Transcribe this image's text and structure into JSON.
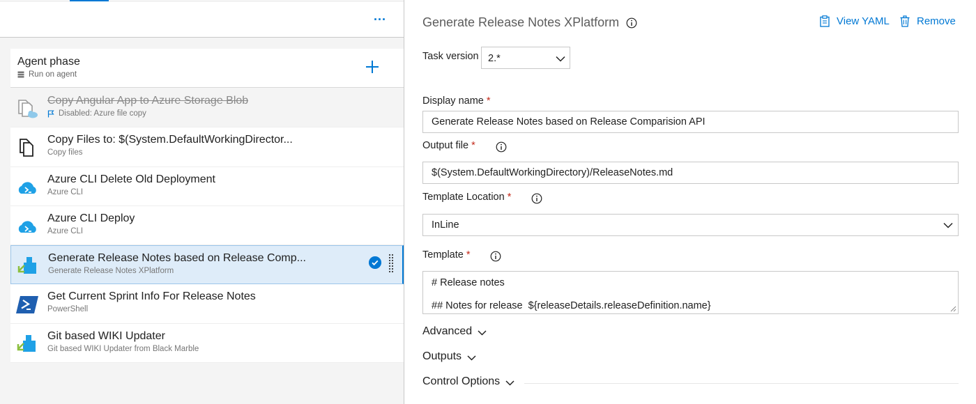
{
  "left_toolbar": {
    "more_label": "..."
  },
  "phase": {
    "title": "Agent phase",
    "subtitle": "Run on agent"
  },
  "tasks": [
    {
      "name": "Copy Angular App to Azure Storage Blob",
      "subtitle": "Disabled: Azure file copy",
      "icon": "azure-file-copy-icon",
      "disabled": true
    },
    {
      "name": "Copy Files to: $(System.DefaultWorkingDirector...",
      "subtitle": "Copy files",
      "icon": "copy-files-icon"
    },
    {
      "name": "Azure CLI Delete Old Deployment",
      "subtitle": "Azure CLI",
      "icon": "azure-cli-icon"
    },
    {
      "name": "Azure CLI Deploy",
      "subtitle": "Azure CLI",
      "icon": "azure-cli-icon"
    },
    {
      "name": "Generate Release Notes based on Release Comp...",
      "subtitle": "Generate Release Notes XPlatform",
      "icon": "extension-task-icon",
      "selected": true
    },
    {
      "name": "Get Current Sprint Info For Release Notes",
      "subtitle": "PowerShell",
      "icon": "powershell-icon"
    },
    {
      "name": "Git based WIKI Updater",
      "subtitle": "Git based WIKI Updater from Black Marble",
      "icon": "extension-task-icon"
    }
  ],
  "details": {
    "title": "Generate Release Notes XPlatform",
    "view_yaml": "View YAML",
    "remove": "Remove",
    "task_version_label": "Task version",
    "task_version_value": "2.*",
    "display_name_label": "Display name",
    "display_name_value": "Generate Release Notes based on Release Comparision API",
    "output_file_label": "Output file",
    "output_file_value": "$(System.DefaultWorkingDirectory)/ReleaseNotes.md",
    "template_location_label": "Template Location",
    "template_location_value": "InLine",
    "template_label": "Template",
    "template_line1": "# Release notes",
    "template_line2": "## Notes for release  ${releaseDetails.releaseDefinition.name}",
    "required_mark": "*",
    "sections": [
      "Advanced",
      "Outputs",
      "Control Options"
    ]
  },
  "colors": {
    "accent": "#0078d4",
    "selected_bg": "#deecf9",
    "required": "#c42b1c"
  }
}
